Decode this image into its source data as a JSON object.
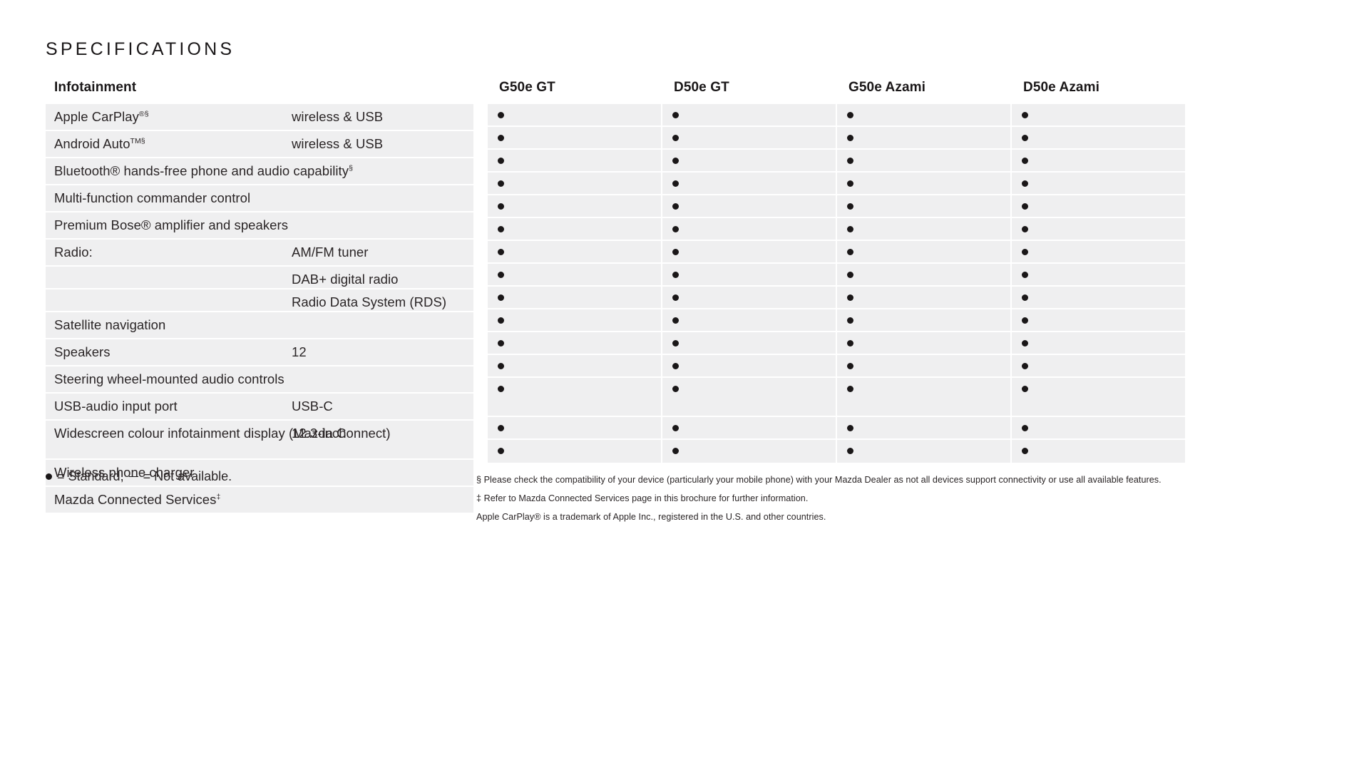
{
  "page": {
    "title": "SPECIFICATIONS"
  },
  "table": {
    "category_header": "Infotainment",
    "columns": [
      "G50e GT",
      "D50e GT",
      "G50e Azami",
      "D50e Azami"
    ],
    "rows": [
      {
        "label": "Apple CarPlay",
        "label_sup": "®§",
        "value": "wireless & USB",
        "marks": [
          "dot",
          "dot",
          "dot",
          "dot"
        ]
      },
      {
        "label": "Android Auto",
        "label_sup": "TM§",
        "value": "wireless & USB",
        "marks": [
          "dot",
          "dot",
          "dot",
          "dot"
        ]
      },
      {
        "label": "Bluetooth® hands-free phone and audio capability",
        "label_sup": "§",
        "value": "",
        "marks": [
          "dot",
          "dot",
          "dot",
          "dot"
        ]
      },
      {
        "label": "Multi-function commander control",
        "label_sup": "",
        "value": "",
        "marks": [
          "dot",
          "dot",
          "dot",
          "dot"
        ]
      },
      {
        "label": "Premium Bose® amplifier and speakers",
        "label_sup": "",
        "value": "",
        "marks": [
          "dot",
          "dot",
          "dot",
          "dot"
        ]
      },
      {
        "label": "Radio:",
        "label_sup": "",
        "value": "AM/FM tuner",
        "marks": [
          "dot",
          "dot",
          "dot",
          "dot"
        ]
      },
      {
        "label": "",
        "label_sup": "",
        "value": "DAB+ digital radio",
        "marks": [
          "dot",
          "dot",
          "dot",
          "dot"
        ]
      },
      {
        "label": "",
        "label_sup": "",
        "value": "Radio Data System (RDS)",
        "marks": [
          "dot",
          "dot",
          "dot",
          "dot"
        ]
      },
      {
        "label": "Satellite navigation",
        "label_sup": "",
        "value": "",
        "marks": [
          "dot",
          "dot",
          "dot",
          "dot"
        ]
      },
      {
        "label": "Speakers",
        "label_sup": "",
        "value": "12",
        "marks": [
          "dot",
          "dot",
          "dot",
          "dot"
        ]
      },
      {
        "label": "Steering wheel-mounted audio controls",
        "label_sup": "",
        "value": "",
        "marks": [
          "dot",
          "dot",
          "dot",
          "dot"
        ]
      },
      {
        "label": "USB-audio input port",
        "label_sup": "",
        "value": "USB-C",
        "marks": [
          "dot",
          "dot",
          "dot",
          "dot"
        ]
      },
      {
        "label": "Widescreen colour infotainment display (Mazda Connect)",
        "label_sup": "",
        "value": "12.3-inch",
        "marks": [
          "dot",
          "dot",
          "dot",
          "dot"
        ],
        "tall": true
      },
      {
        "label": "Wireless phone charger",
        "label_sup": "",
        "value": "",
        "marks": [
          "dot",
          "dot",
          "dot",
          "dot"
        ]
      },
      {
        "label": "Mazda Connected Services",
        "label_sup": "‡",
        "value": "",
        "marks": [
          "dot",
          "dot",
          "dot",
          "dot"
        ]
      }
    ]
  },
  "legend": {
    "standard_text": "= Standard,",
    "not_available_text": "= Not available."
  },
  "footnotes": [
    "§ Please check the compatibility of your device (particularly your mobile phone) with your Mazda Dealer as not all devices support connectivity or use all available features.",
    "‡ Refer to Mazda Connected Services page in this brochure for further information.",
    "Apple CarPlay® is a trademark of Apple Inc., registered in the U.S. and other countries."
  ]
}
